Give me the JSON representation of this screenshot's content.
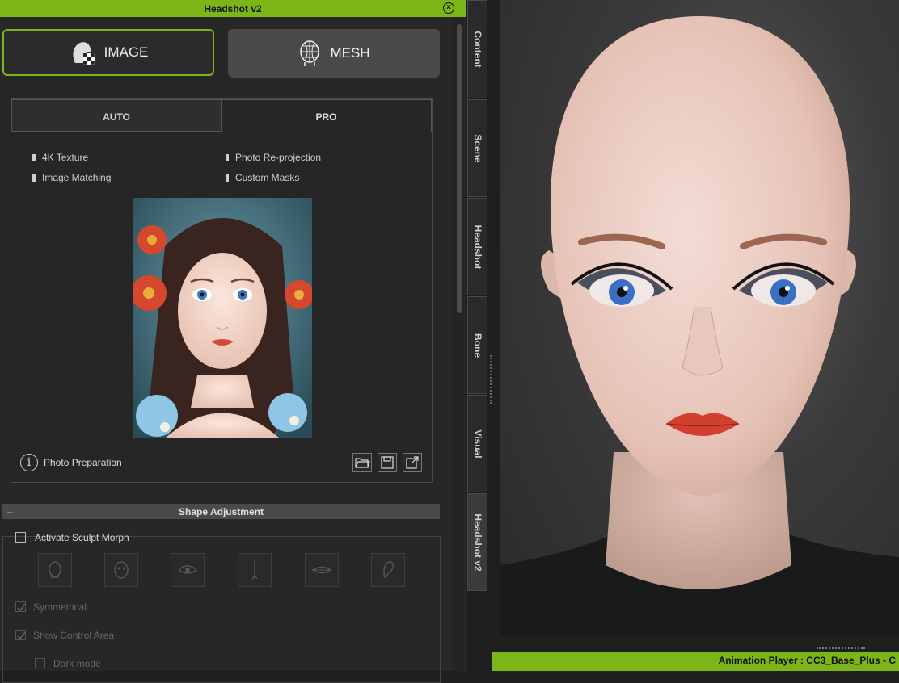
{
  "window": {
    "title": "Headshot v2",
    "close_icon": "close-icon"
  },
  "mode_buttons": {
    "image_label": "IMAGE",
    "mesh_label": "MESH"
  },
  "tabs": {
    "auto": "AUTO",
    "pro": "PRO"
  },
  "features": {
    "texture": "4K Texture",
    "reprojection": "Photo Re-projection",
    "matching": "Image Matching",
    "masks": "Custom Masks"
  },
  "photo_prep_link": "Photo Preparation",
  "shape_adjustment": {
    "header": "Shape Adjustment",
    "collapse_symbol": "–",
    "activate_sculpt": "Activate Sculpt Morph",
    "symmetrical": "Symmetrical",
    "show_control_area": "Show Control Area",
    "dark_mode": "Dark mode",
    "symmetrical_checked": true,
    "show_control_area_checked": true,
    "activate_checked": false
  },
  "side_tabs": [
    "Content",
    "Scene",
    "Headshot",
    "Bone",
    "Visual",
    "Headshot v2"
  ],
  "active_side_tab": "Headshot v2",
  "animation_player": "Animation Player : CC3_Base_Plus - C",
  "colors": {
    "accent": "#7cb518",
    "panel_bg": "#272727"
  }
}
